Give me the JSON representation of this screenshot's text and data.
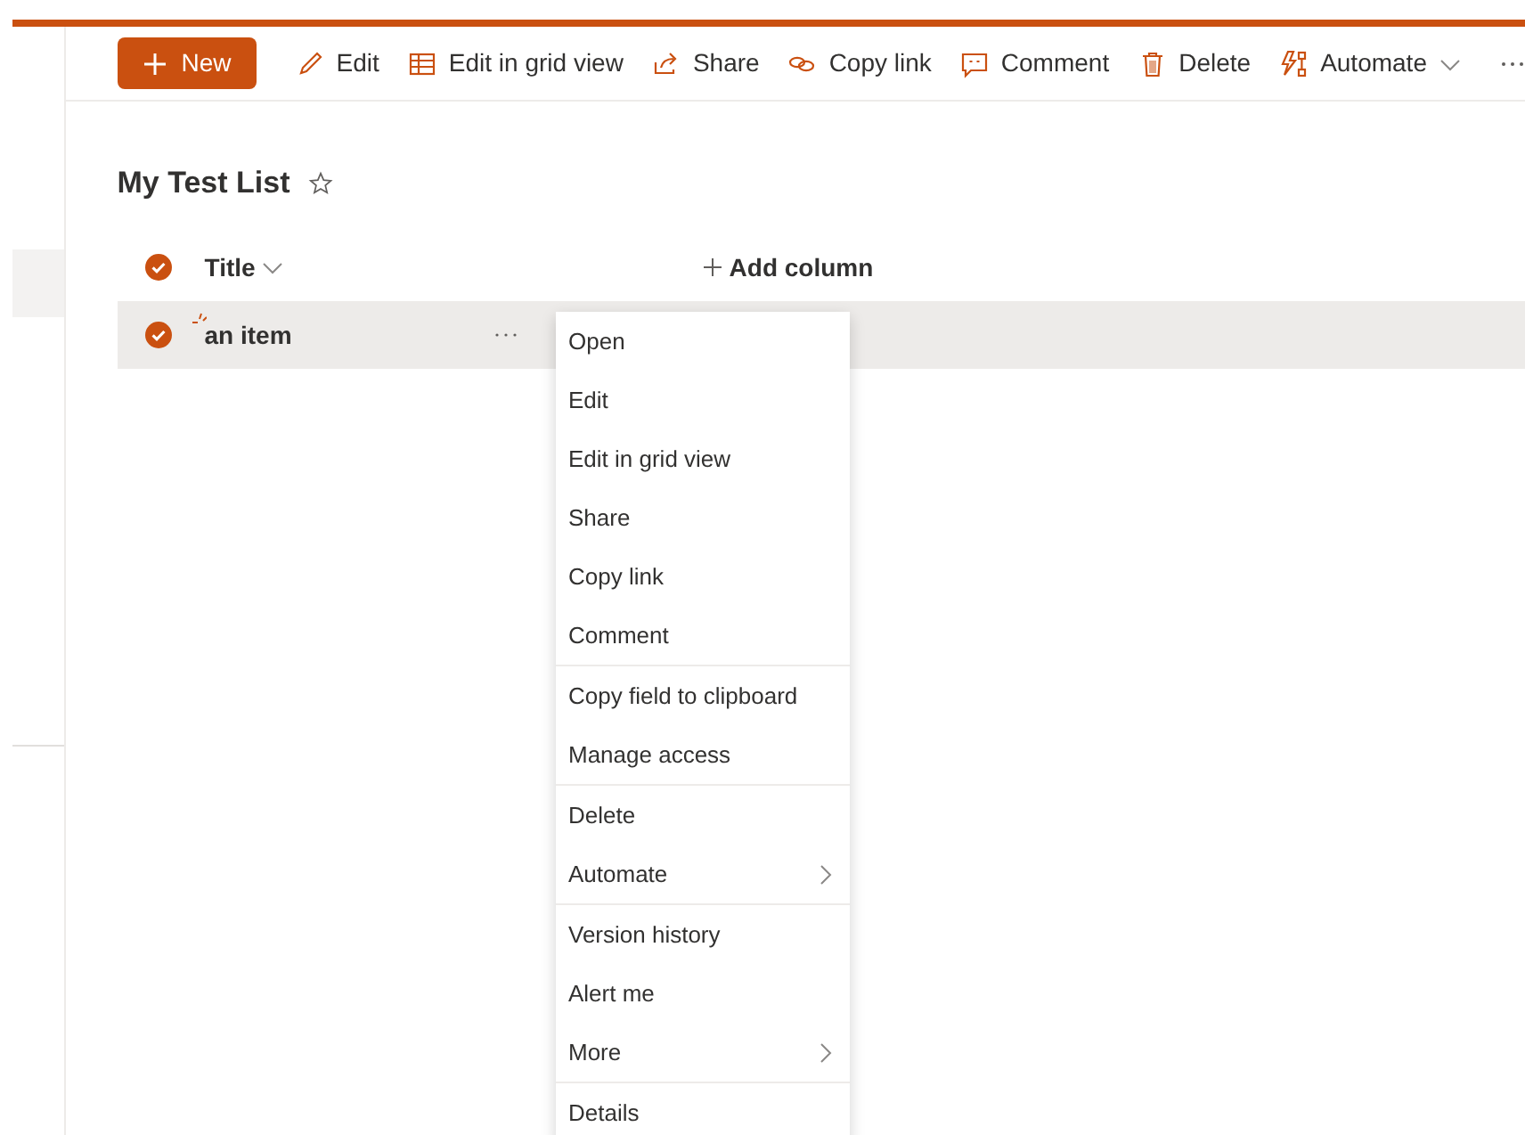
{
  "toolbar": [
    {
      "label": "New",
      "kind": "primary"
    },
    {
      "label": "Edit",
      "kind": "command"
    },
    {
      "label": "Edit in grid view",
      "kind": "command"
    },
    {
      "label": "Share",
      "kind": "command"
    },
    {
      "label": "Copy link",
      "kind": "command"
    },
    {
      "label": "Comment",
      "kind": "command"
    },
    {
      "label": "Delete",
      "kind": "command"
    },
    {
      "label": "Automate",
      "kind": "dropdown"
    }
  ],
  "list": {
    "title": "My Test List",
    "favorite": false,
    "header": {
      "checked": true,
      "column": "Title",
      "add_column": "Add column"
    },
    "rows": [
      {
        "title": "an item",
        "checked": true,
        "is_new": true,
        "selected": true
      }
    ]
  },
  "context_menu": {
    "groups": [
      [
        {
          "label": "Open",
          "submenu": false
        },
        {
          "label": "Edit",
          "submenu": false
        },
        {
          "label": "Edit in grid view",
          "submenu": false
        },
        {
          "label": "Share",
          "submenu": false
        },
        {
          "label": "Copy link",
          "submenu": false
        },
        {
          "label": "Comment",
          "submenu": false
        }
      ],
      [
        {
          "label": "Copy field to clipboard",
          "submenu": false
        },
        {
          "label": "Manage access",
          "submenu": false
        }
      ],
      [
        {
          "label": "Delete",
          "submenu": false
        },
        {
          "label": "Automate",
          "submenu": true
        }
      ],
      [
        {
          "label": "Version history",
          "submenu": false
        },
        {
          "label": "Alert me",
          "submenu": false
        },
        {
          "label": "More",
          "submenu": true
        }
      ],
      [
        {
          "label": "Details",
          "submenu": false
        }
      ]
    ]
  }
}
